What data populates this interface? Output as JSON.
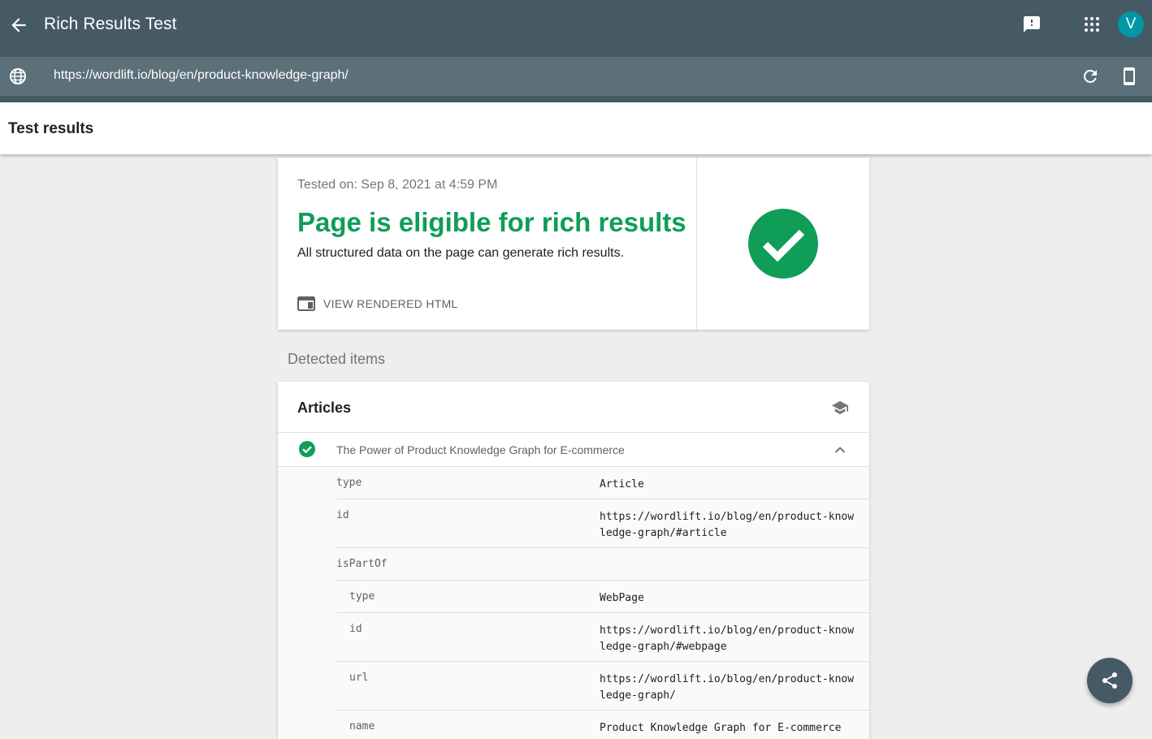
{
  "app": {
    "title": "Rich Results Test",
    "avatar_letter": "V",
    "avatar_color": "#0097a7",
    "header_color": "#455a64",
    "back_icon": "arrow-back-icon",
    "feedback_icon": "feedback-icon",
    "apps_icon": "apps-grid-icon"
  },
  "urlbar": {
    "url": "https://wordlift.io/blog/en/product-knowledge-graph/",
    "icons": [
      "globe-icon",
      "refresh-icon",
      "smartphone-icon"
    ]
  },
  "results_header": {
    "label": "Test results"
  },
  "summary": {
    "tested_on": "Tested on: Sep 8, 2021 at 4:59 PM",
    "headline": "Page is eligible for rich results",
    "description": "All structured data on the page can generate rich results.",
    "view_html_label": "VIEW RENDERED HTML",
    "status_color": "#0f9d58"
  },
  "detected": {
    "label": "Detected items",
    "section_title": "Articles",
    "item_title": "The Power of Product Knowledge Graph for E-commerce",
    "properties": [
      {
        "key": "type",
        "value": "Article",
        "depth": 0
      },
      {
        "key": "id",
        "value": "https://wordlift.io/blog/en/product-knowledge-graph/#article",
        "depth": 0
      },
      {
        "key": "isPartOf",
        "value": "",
        "depth": 0
      },
      {
        "key": "type",
        "value": "WebPage",
        "depth": 1
      },
      {
        "key": "id",
        "value": "https://wordlift.io/blog/en/product-knowledge-graph/#webpage",
        "depth": 1
      },
      {
        "key": "url",
        "value": "https://wordlift.io/blog/en/product-knowledge-graph/",
        "depth": 1
      },
      {
        "key": "name",
        "value": "Product Knowledge Graph for E-commerce",
        "depth": 1
      }
    ]
  },
  "fab": {
    "icon": "share-icon"
  }
}
